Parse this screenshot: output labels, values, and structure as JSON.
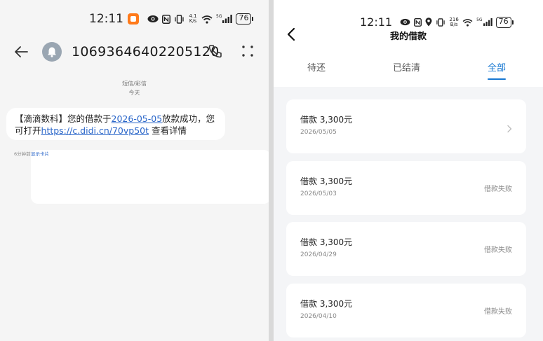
{
  "left": {
    "status_bar": {
      "time": "12:11",
      "net_speed_top": "4.1",
      "net_speed_bottom": "K/s",
      "network_type": "5G",
      "battery": "76"
    },
    "header": {
      "sender_number": "10693646402205120"
    },
    "message_meta": {
      "type": "短信/彩信",
      "day": "今天"
    },
    "message": {
      "prefix": "【滴滴数科】您的借款于",
      "date_link": "2026-05-05",
      "middle": "放款成功，您可打开",
      "url": "https://c.didi.cn/70vp50t",
      "suffix": " 查看详情"
    },
    "footer": {
      "time_ago": "6分钟前",
      "show_card": "显示卡片"
    }
  },
  "right": {
    "status_bar": {
      "time": "12:11",
      "net_speed_top": "216",
      "net_speed_bottom": "B/s",
      "network_type": "5G",
      "battery": "76"
    },
    "title": "我的借款",
    "tabs": [
      {
        "label": "待还"
      },
      {
        "label": "已结清"
      },
      {
        "label": "全部"
      }
    ],
    "active_tab": "全部",
    "loans": [
      {
        "amount": "借款  3,300元",
        "date": "2026/05/05",
        "status": ""
      },
      {
        "amount": "借款  3,300元",
        "date": "2026/05/03",
        "status": "借款失败"
      },
      {
        "amount": "借款  3,300元",
        "date": "2026/04/29",
        "status": "借款失败"
      },
      {
        "amount": "借款  3,300元",
        "date": "2026/04/10",
        "status": "借款失败"
      }
    ]
  },
  "colors": {
    "accent_blue": "#1677d2",
    "link_blue": "#2a66c9",
    "badge_orange": "#ff7a1a"
  }
}
